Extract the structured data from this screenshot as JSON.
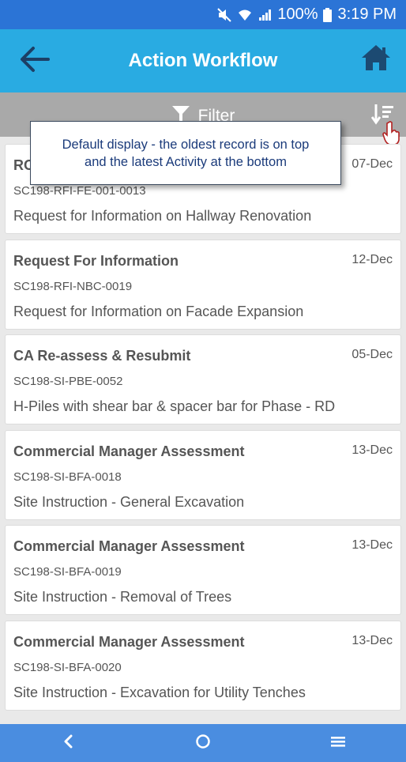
{
  "status_bar": {
    "battery": "100%",
    "time": "3:19 PM",
    "icons": [
      "mute-icon",
      "wifi-icon",
      "signal-icon",
      "battery-icon"
    ]
  },
  "app_bar": {
    "title": "Action Workflow",
    "icons": [
      "back-arrow-icon",
      "home-icon"
    ],
    "accent": "#29abe2"
  },
  "filter_bar": {
    "filter_label": "Filter",
    "icons": [
      "filter-funnel-icon",
      "sort-icon"
    ]
  },
  "tooltip": {
    "line1": "Default display - the oldest record is on top",
    "line2": "and the latest Activity at the bottom"
  },
  "cards": [
    {
      "title": "RO",
      "date": "07-Dec",
      "code": "SC198-RFI-FE-001-0013",
      "description": "Request for Information on Hallway Renovation"
    },
    {
      "title": "Request For Information",
      "date": "12-Dec",
      "code": "SC198-RFI-NBC-0019",
      "description": "Request for Information on Facade Expansion"
    },
    {
      "title": "CA Re-assess & Resubmit",
      "date": "05-Dec",
      "code": "SC198-SI-PBE-0052",
      "description": "H-Piles with shear bar & spacer bar for Phase - RD"
    },
    {
      "title": "Commercial Manager Assessment",
      "date": "13-Dec",
      "code": "SC198-SI-BFA-0018",
      "description": "Site Instruction - General Excavation"
    },
    {
      "title": "Commercial Manager Assessment",
      "date": "13-Dec",
      "code": "SC198-SI-BFA-0019",
      "description": "Site Instruction - Removal of Trees"
    },
    {
      "title": "Commercial Manager Assessment",
      "date": "13-Dec",
      "code": "SC198-SI-BFA-0020",
      "description": "Site Instruction - Excavation for Utility Tenches"
    }
  ],
  "nav_bar": {
    "icons": [
      "nav-back-icon",
      "nav-home-circle-icon",
      "nav-menu-icon"
    ]
  }
}
